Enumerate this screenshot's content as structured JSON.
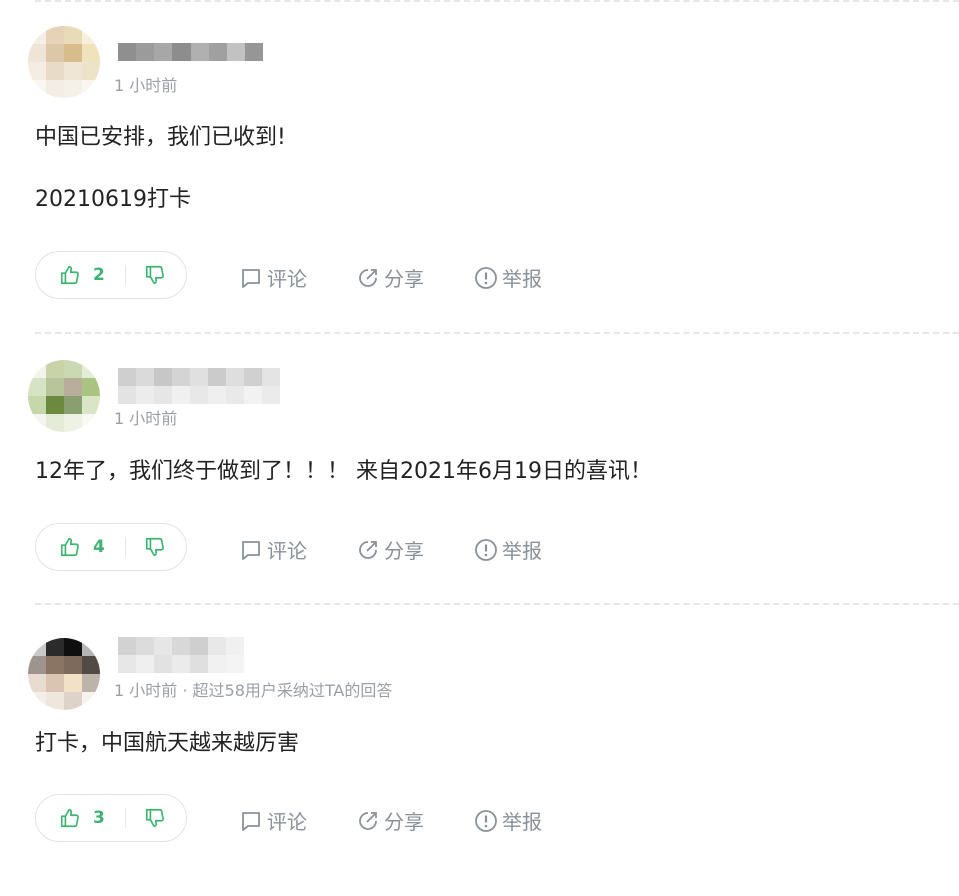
{
  "accent_color": "#3cb371",
  "actions": {
    "comment_label": "评论",
    "share_label": "分享",
    "report_label": "举报"
  },
  "answers": [
    {
      "meta": "1 小时前",
      "paragraphs": [
        "中国已安排，我们已收到!",
        "20210619打卡"
      ],
      "likes": "2"
    },
    {
      "meta": "1 小时前",
      "paragraphs": [
        "12年了，我们终于做到了！！！ 来自2021年6月19日的喜讯！"
      ],
      "likes": "4"
    },
    {
      "meta": "1 小时前 · 超过58用户采纳过TA的回答",
      "paragraphs": [
        "打卡，中国航天越来越厉害"
      ],
      "likes": "3"
    }
  ]
}
